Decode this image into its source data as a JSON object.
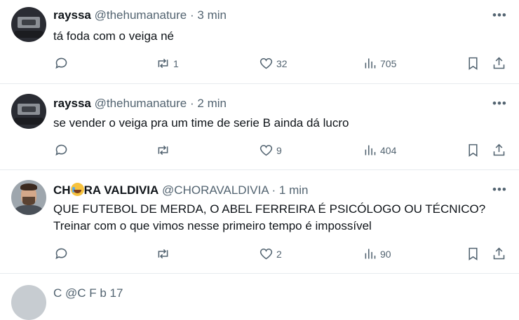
{
  "tweets": [
    {
      "name": "rayssa",
      "handle": "@thehumanature",
      "time": "3 min",
      "text": "tá foda com o veiga né",
      "replies": "",
      "retweets": "1",
      "likes": "32",
      "views": "705"
    },
    {
      "name": "rayssa",
      "handle": "@thehumanature",
      "time": "2 min",
      "text": "se vender o veiga pra um time de serie B ainda dá lucro",
      "replies": "",
      "retweets": "",
      "likes": "9",
      "views": "404"
    },
    {
      "name_part1": "CH",
      "name_part2": "RA VALDIVIA",
      "handle": "@CHORAVALDIVIA",
      "time": "1 min",
      "text_line1": "QUE FUTEBOL DE MERDA, O ABEL FERREIRA É PSICÓLOGO OU TÉCNICO?",
      "text_line2": "Treinar com o que vimos nesse primeiro tempo é impossível",
      "replies": "",
      "retweets": "",
      "likes": "2",
      "views": "90"
    }
  ],
  "separator": "·",
  "more_glyph": "•••",
  "partial_header": "C          @C          F  b  17",
  "icons": [
    "reply-icon",
    "retweet-icon",
    "like-icon",
    "views-icon",
    "bookmark-icon",
    "share-icon",
    "more-icon"
  ]
}
